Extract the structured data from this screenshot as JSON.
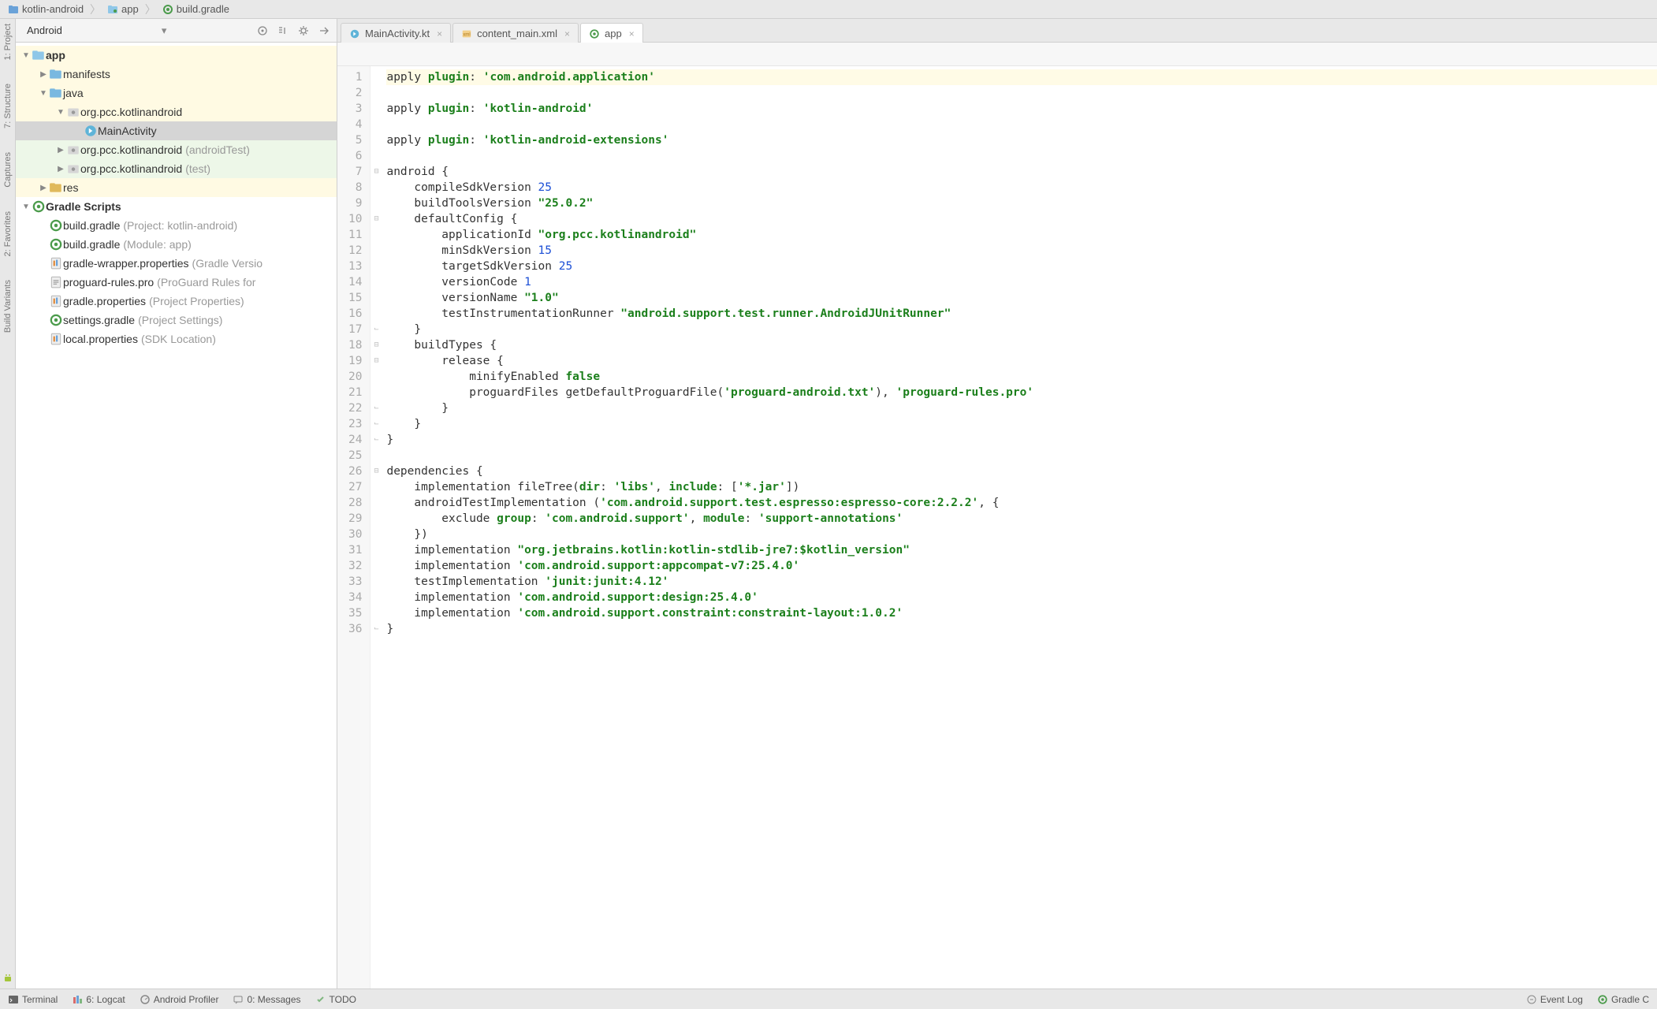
{
  "breadcrumb": [
    {
      "label": "kotlin-android",
      "icon": "folder"
    },
    {
      "label": "app",
      "icon": "module"
    },
    {
      "label": "build.gradle",
      "icon": "gradle"
    }
  ],
  "leftRail": {
    "tabs": [
      "1: Project",
      "7: Structure",
      "Captures",
      "2: Favorites",
      "Build Variants"
    ]
  },
  "projectPanel": {
    "viewLabel": "Android",
    "tree": [
      {
        "indent": 0,
        "arrow": "down",
        "icon": "module",
        "label": "app",
        "bold": true,
        "highlight": "yellow"
      },
      {
        "indent": 1,
        "arrow": "right",
        "icon": "folder-src",
        "label": "manifests",
        "highlight": "yellow"
      },
      {
        "indent": 1,
        "arrow": "down",
        "icon": "folder-src",
        "label": "java",
        "highlight": "yellow"
      },
      {
        "indent": 2,
        "arrow": "down",
        "icon": "package",
        "label": "org.pcc.kotlinandroid",
        "highlight": "yellow"
      },
      {
        "indent": 3,
        "arrow": "",
        "icon": "kotlin-class",
        "label": "MainActivity",
        "highlight": "selected"
      },
      {
        "indent": 2,
        "arrow": "right",
        "icon": "package",
        "label": "org.pcc.kotlinandroid",
        "note": "(androidTest)",
        "highlight": "green"
      },
      {
        "indent": 2,
        "arrow": "right",
        "icon": "package",
        "label": "org.pcc.kotlinandroid",
        "note": "(test)",
        "highlight": "green"
      },
      {
        "indent": 1,
        "arrow": "right",
        "icon": "folder-res",
        "label": "res",
        "highlight": "yellow"
      },
      {
        "indent": 0,
        "arrow": "down",
        "icon": "gradle",
        "label": "Gradle Scripts",
        "bold": true
      },
      {
        "indent": 1,
        "arrow": "",
        "icon": "gradle",
        "label": "build.gradle",
        "note": "(Project: kotlin-android)"
      },
      {
        "indent": 1,
        "arrow": "",
        "icon": "gradle",
        "label": "build.gradle",
        "note": "(Module: app)"
      },
      {
        "indent": 1,
        "arrow": "",
        "icon": "properties",
        "label": "gradle-wrapper.properties",
        "note": "(Gradle Versio"
      },
      {
        "indent": 1,
        "arrow": "",
        "icon": "file",
        "label": "proguard-rules.pro",
        "note": "(ProGuard Rules for"
      },
      {
        "indent": 1,
        "arrow": "",
        "icon": "properties",
        "label": "gradle.properties",
        "note": "(Project Properties)"
      },
      {
        "indent": 1,
        "arrow": "",
        "icon": "gradle",
        "label": "settings.gradle",
        "note": "(Project Settings)"
      },
      {
        "indent": 1,
        "arrow": "",
        "icon": "properties",
        "label": "local.properties",
        "note": "(SDK Location)"
      }
    ]
  },
  "editor": {
    "tabs": [
      {
        "label": "MainActivity.kt",
        "icon": "kotlin-class",
        "active": false
      },
      {
        "label": "content_main.xml",
        "icon": "xml",
        "active": false
      },
      {
        "label": "app",
        "icon": "gradle",
        "active": true
      }
    ],
    "code": [
      {
        "n": 1,
        "caret": true,
        "tokens": [
          [
            "id",
            "apply "
          ],
          [
            "kw",
            "plugin"
          ],
          [
            "id",
            ": "
          ],
          [
            "str",
            "'com.android.application'"
          ]
        ]
      },
      {
        "n": 2,
        "tokens": []
      },
      {
        "n": 3,
        "tokens": [
          [
            "id",
            "apply "
          ],
          [
            "kw",
            "plugin"
          ],
          [
            "id",
            ": "
          ],
          [
            "str",
            "'kotlin-android'"
          ]
        ]
      },
      {
        "n": 4,
        "tokens": []
      },
      {
        "n": 5,
        "tokens": [
          [
            "id",
            "apply "
          ],
          [
            "kw",
            "plugin"
          ],
          [
            "id",
            ": "
          ],
          [
            "str",
            "'kotlin-android-extensions'"
          ]
        ]
      },
      {
        "n": 6,
        "tokens": []
      },
      {
        "n": 7,
        "fold": "open",
        "tokens": [
          [
            "id",
            "android {"
          ]
        ]
      },
      {
        "n": 8,
        "tokens": [
          [
            "id",
            "    compileSdkVersion "
          ],
          [
            "num",
            "25"
          ]
        ]
      },
      {
        "n": 9,
        "tokens": [
          [
            "id",
            "    buildToolsVersion "
          ],
          [
            "str",
            "\"25.0.2\""
          ]
        ]
      },
      {
        "n": 10,
        "fold": "open",
        "tokens": [
          [
            "id",
            "    defaultConfig {"
          ]
        ]
      },
      {
        "n": 11,
        "tokens": [
          [
            "id",
            "        applicationId "
          ],
          [
            "str",
            "\"org.pcc.kotlinandroid\""
          ]
        ]
      },
      {
        "n": 12,
        "tokens": [
          [
            "id",
            "        minSdkVersion "
          ],
          [
            "num",
            "15"
          ]
        ]
      },
      {
        "n": 13,
        "tokens": [
          [
            "id",
            "        targetSdkVersion "
          ],
          [
            "num",
            "25"
          ]
        ]
      },
      {
        "n": 14,
        "tokens": [
          [
            "id",
            "        versionCode "
          ],
          [
            "num",
            "1"
          ]
        ]
      },
      {
        "n": 15,
        "tokens": [
          [
            "id",
            "        versionName "
          ],
          [
            "str",
            "\"1.0\""
          ]
        ]
      },
      {
        "n": 16,
        "tokens": [
          [
            "id",
            "        testInstrumentationRunner "
          ],
          [
            "str",
            "\"android.support.test.runner.AndroidJUnitRunner\""
          ]
        ]
      },
      {
        "n": 17,
        "fold": "close",
        "tokens": [
          [
            "id",
            "    }"
          ]
        ]
      },
      {
        "n": 18,
        "fold": "open",
        "tokens": [
          [
            "id",
            "    buildTypes {"
          ]
        ]
      },
      {
        "n": 19,
        "fold": "open",
        "tokens": [
          [
            "id",
            "        release {"
          ]
        ]
      },
      {
        "n": 20,
        "tokens": [
          [
            "id",
            "            minifyEnabled "
          ],
          [
            "bool",
            "false"
          ]
        ]
      },
      {
        "n": 21,
        "tokens": [
          [
            "id",
            "            proguardFiles getDefaultProguardFile("
          ],
          [
            "str",
            "'proguard-android.txt'"
          ],
          [
            "id",
            "), "
          ],
          [
            "str",
            "'proguard-rules.pro'"
          ]
        ]
      },
      {
        "n": 22,
        "fold": "close",
        "tokens": [
          [
            "id",
            "        }"
          ]
        ]
      },
      {
        "n": 23,
        "fold": "close",
        "tokens": [
          [
            "id",
            "    }"
          ]
        ]
      },
      {
        "n": 24,
        "fold": "close",
        "tokens": [
          [
            "id",
            "}"
          ]
        ]
      },
      {
        "n": 25,
        "tokens": []
      },
      {
        "n": 26,
        "fold": "open",
        "tokens": [
          [
            "id",
            "dependencies {"
          ]
        ]
      },
      {
        "n": 27,
        "tokens": [
          [
            "id",
            "    implementation fileTree("
          ],
          [
            "arg",
            "dir"
          ],
          [
            "id",
            ": "
          ],
          [
            "str",
            "'libs'"
          ],
          [
            "id",
            ", "
          ],
          [
            "arg",
            "include"
          ],
          [
            "id",
            ": ["
          ],
          [
            "str",
            "'*.jar'"
          ],
          [
            "id",
            "])"
          ]
        ]
      },
      {
        "n": 28,
        "tokens": [
          [
            "id",
            "    androidTestImplementation ("
          ],
          [
            "str",
            "'com.android.support.test.espresso:espresso-core:2.2.2'"
          ],
          [
            "id",
            ", {"
          ]
        ]
      },
      {
        "n": 29,
        "tokens": [
          [
            "id",
            "        exclude "
          ],
          [
            "arg",
            "group"
          ],
          [
            "id",
            ": "
          ],
          [
            "str",
            "'com.android.support'"
          ],
          [
            "id",
            ", "
          ],
          [
            "arg",
            "module"
          ],
          [
            "id",
            ": "
          ],
          [
            "str",
            "'support-annotations'"
          ]
        ]
      },
      {
        "n": 30,
        "tokens": [
          [
            "id",
            "    })"
          ]
        ]
      },
      {
        "n": 31,
        "tokens": [
          [
            "id",
            "    implementation "
          ],
          [
            "str",
            "\"org.jetbrains.kotlin:kotlin-stdlib-jre7:$kotlin_version\""
          ]
        ]
      },
      {
        "n": 32,
        "tokens": [
          [
            "id",
            "    implementation "
          ],
          [
            "str",
            "'com.android.support:appcompat-v7:25.4.0'"
          ]
        ]
      },
      {
        "n": 33,
        "tokens": [
          [
            "id",
            "    testImplementation "
          ],
          [
            "str",
            "'junit:junit:4.12'"
          ]
        ]
      },
      {
        "n": 34,
        "tokens": [
          [
            "id",
            "    implementation "
          ],
          [
            "str",
            "'com.android.support:design:25.4.0'"
          ]
        ]
      },
      {
        "n": 35,
        "tokens": [
          [
            "id",
            "    implementation "
          ],
          [
            "str",
            "'com.android.support.constraint:constraint-layout:1.0.2'"
          ]
        ]
      },
      {
        "n": 36,
        "fold": "close",
        "tokens": [
          [
            "id",
            "}"
          ]
        ]
      }
    ]
  },
  "statusbar": {
    "left": [
      {
        "label": "Terminal",
        "icon": "terminal"
      },
      {
        "label": "6: Logcat",
        "icon": "logcat"
      },
      {
        "label": "Android Profiler",
        "icon": "profiler"
      },
      {
        "label": "0: Messages",
        "icon": "messages"
      },
      {
        "label": "TODO",
        "icon": "todo"
      }
    ],
    "right": [
      {
        "label": "Event Log",
        "icon": "eventlog"
      },
      {
        "label": "Gradle C",
        "icon": "gradle"
      }
    ]
  }
}
